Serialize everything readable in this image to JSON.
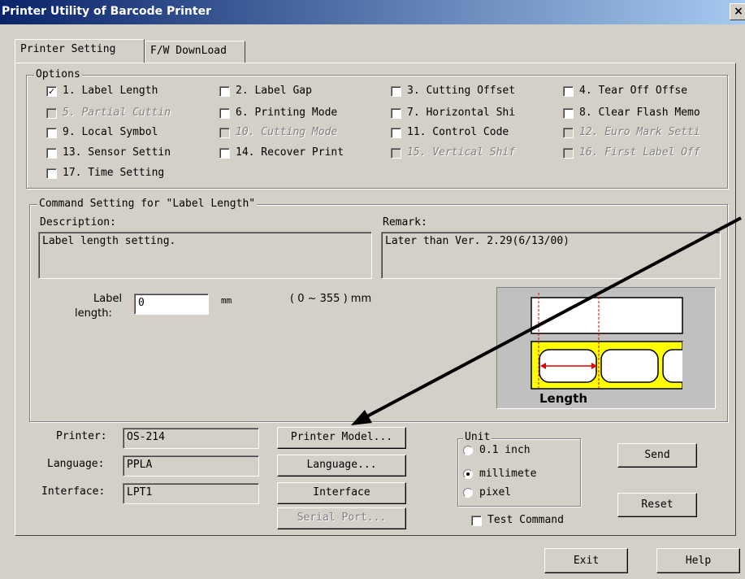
{
  "window": {
    "title": "Printer Utility of Barcode Printer",
    "close_glyph": "×"
  },
  "tabs": [
    {
      "label": "Printer Setting",
      "active": true
    },
    {
      "label": "F/W DownLoad",
      "active": false
    }
  ],
  "options": {
    "legend": "Options",
    "items": [
      {
        "label": "1. Label Length",
        "checked": true,
        "enabled": true
      },
      {
        "label": "2. Label Gap",
        "checked": false,
        "enabled": true
      },
      {
        "label": "3. Cutting Offset",
        "checked": false,
        "enabled": true
      },
      {
        "label": "4. Tear Off Offse",
        "checked": false,
        "enabled": true
      },
      {
        "label": "5. Partial Cuttin",
        "checked": false,
        "enabled": false
      },
      {
        "label": "6. Printing Mode",
        "checked": false,
        "enabled": true
      },
      {
        "label": "7. Horizontal Shi",
        "checked": false,
        "enabled": true
      },
      {
        "label": "8. Clear Flash Memo",
        "checked": false,
        "enabled": true
      },
      {
        "label": "9. Local Symbol",
        "checked": false,
        "enabled": true
      },
      {
        "label": "10. Cutting Mode",
        "checked": false,
        "enabled": false
      },
      {
        "label": "11. Control Code",
        "checked": false,
        "enabled": true
      },
      {
        "label": "12. Euro Mark Setti",
        "checked": false,
        "enabled": false
      },
      {
        "label": "13. Sensor Settin",
        "checked": false,
        "enabled": true
      },
      {
        "label": "14. Recover Print",
        "checked": false,
        "enabled": true
      },
      {
        "label": "15. Vertical Shif",
        "checked": false,
        "enabled": false
      },
      {
        "label": "16. First Label Off",
        "checked": false,
        "enabled": false
      },
      {
        "label": "17. Time Setting",
        "checked": false,
        "enabled": true
      }
    ]
  },
  "command": {
    "legend": "Command Setting for \"Label Length\"",
    "description_label": "Description:",
    "description": "Label length setting.",
    "remark_label": "Remark:",
    "remark": "Later than Ver. 2.29(6/13/00)",
    "field_label_line1": "Label",
    "field_label_line2": "length:",
    "field_value": "0",
    "unit": "mm",
    "range": "( 0 ~ 355 ) mm",
    "diagram_label": "Length"
  },
  "printer_info": {
    "printer_label": "Printer:",
    "printer_value": "OS-214",
    "language_label": "Language:",
    "language_value": "PPLA",
    "interface_label": "Interface:",
    "interface_value": "LPT1"
  },
  "buttons": {
    "printer_model": "Printer Model...",
    "language": "Language...",
    "interface": "Interface",
    "serial_port": "Serial Port...",
    "send": "Send",
    "reset": "Reset",
    "exit": "Exit",
    "help": "Help"
  },
  "unit": {
    "legend": "Unit",
    "options": [
      {
        "label": "0.1 inch",
        "selected": false
      },
      {
        "label": "millimete",
        "selected": true
      },
      {
        "label": "pixel",
        "selected": false
      }
    ]
  },
  "test_command": {
    "label": "Test Command",
    "checked": false
  }
}
